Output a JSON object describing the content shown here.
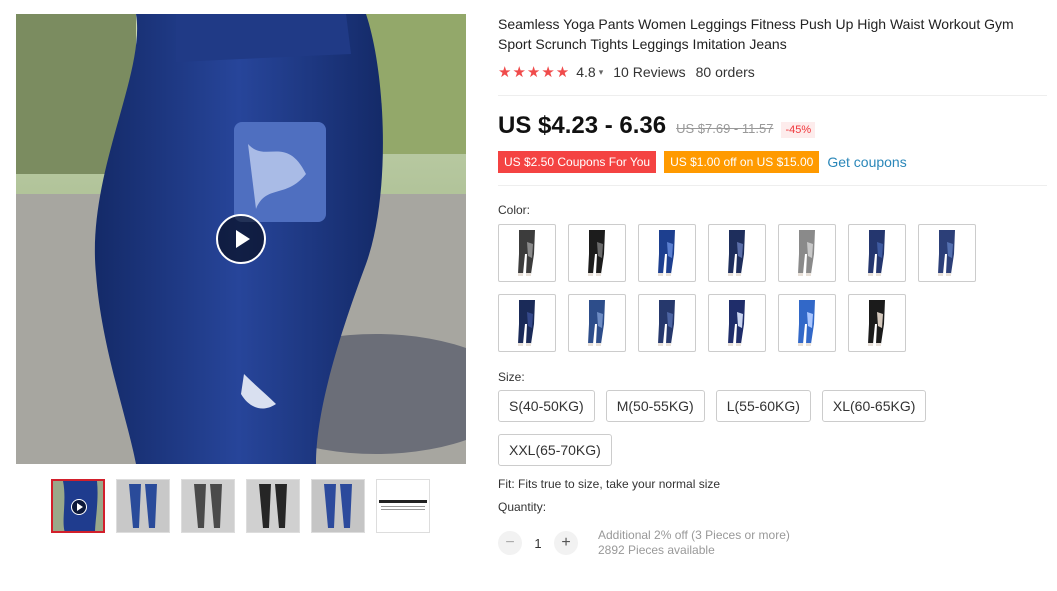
{
  "product": {
    "title": "Seamless Yoga Pants Women Leggings Fitness Push Up High Waist Workout Gym Sport Scrunch Tights Leggings Imitation Jeans",
    "stars": "★★★★★",
    "rating": "4.8",
    "reviews": "10 Reviews",
    "orders": "80 orders"
  },
  "price": {
    "current": "US $4.23 - 6.36",
    "original": "US $7.69 - 11.57",
    "discount": "-45%"
  },
  "coupons": {
    "coupon1": "US $2.50 Coupons For You",
    "coupon2": "US $1.00 off on US $15.00",
    "get_coupons": "Get coupons"
  },
  "color": {
    "label": "Color:",
    "swatches": [
      {
        "icon": "leggings-camo-gray",
        "main": "#3c3c3c",
        "accent": "#8a8a8a"
      },
      {
        "icon": "leggings-black-print",
        "main": "#1c1c1c",
        "accent": "#6a6a6a"
      },
      {
        "icon": "leggings-blue-jeans",
        "main": "#1d3f8f",
        "accent": "#5a7fd0"
      },
      {
        "icon": "leggings-navy-jeans",
        "main": "#1e2e5c",
        "accent": "#5a6ea8"
      },
      {
        "icon": "leggings-gray-denim",
        "main": "#8a8a8a",
        "accent": "#c8c8c8"
      },
      {
        "icon": "leggings-dark-blue",
        "main": "#24366e",
        "accent": "#3e5aa0"
      },
      {
        "icon": "leggings-denim-blue",
        "main": "#2c3f78",
        "accent": "#5470b0"
      },
      {
        "icon": "leggings-navy",
        "main": "#1a2a58",
        "accent": "#34488a"
      },
      {
        "icon": "leggings-blue-light",
        "main": "#2d4d8a",
        "accent": "#6d8cc4"
      },
      {
        "icon": "leggings-denim-dark",
        "main": "#26386c",
        "accent": "#4c64a2"
      },
      {
        "icon": "leggings-navy-ombre",
        "main": "#1f2d6a",
        "accent": "#c9d4f0"
      },
      {
        "icon": "leggings-bright-blue",
        "main": "#3268c8",
        "accent": "#a9c6ff"
      },
      {
        "icon": "leggings-black-ombre",
        "main": "#1b1b1b",
        "accent": "#d4c8bc"
      }
    ]
  },
  "size": {
    "label": "Size:",
    "options": [
      "S(40-50KG)",
      "M(50-55KG)",
      "L(55-60KG)",
      "XL(60-65KG)",
      "XXL(65-70KG)"
    ]
  },
  "fit": "Fit: Fits true to size, take your normal size",
  "quantity": {
    "label": "Quantity:",
    "minus": "−",
    "plus": "+",
    "value": "1",
    "note1": "Additional 2% off (3 Pieces or more)",
    "note2": "2892 Pieces available"
  },
  "icons": {
    "play": "play-icon",
    "caret": "▾"
  }
}
